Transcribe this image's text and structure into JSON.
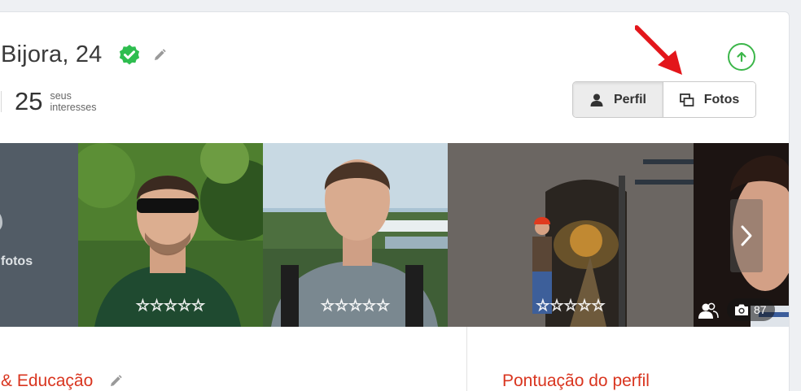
{
  "profile": {
    "name_age": "Bijora, 24",
    "stat": {
      "number": "25",
      "label_line1": "seus",
      "label_line2": "interesses"
    }
  },
  "toggle": {
    "profile_label": "Perfil",
    "photos_label": "Fotos",
    "active": "Perfil"
  },
  "gallery": {
    "more_label": "fotos",
    "stars": "☆☆☆☆☆",
    "photo_count": "87",
    "tiles": [
      {
        "subject": "man with sunglasses in forest",
        "stars": 0
      },
      {
        "subject": "young man with backpack, river background",
        "stars": 0
      },
      {
        "subject": "person with red helmet in tunnel",
        "stars": 0
      },
      {
        "subject": "close-up face, partially visible",
        "stars": 0
      }
    ]
  },
  "sections": {
    "education_title": "& Educação",
    "score_title": "Pontuação do perfil"
  },
  "colors": {
    "accent_red": "#d9351f",
    "verified_green": "#2ebd4f",
    "upload_green": "#3cb64a",
    "arrow_red": "#e3161b"
  },
  "icons": [
    "verified-check-icon",
    "pencil-icon",
    "upload-arrow-icon",
    "user-icon",
    "photos-icon",
    "chevron-right-icon",
    "group-icon",
    "camera-icon"
  ]
}
